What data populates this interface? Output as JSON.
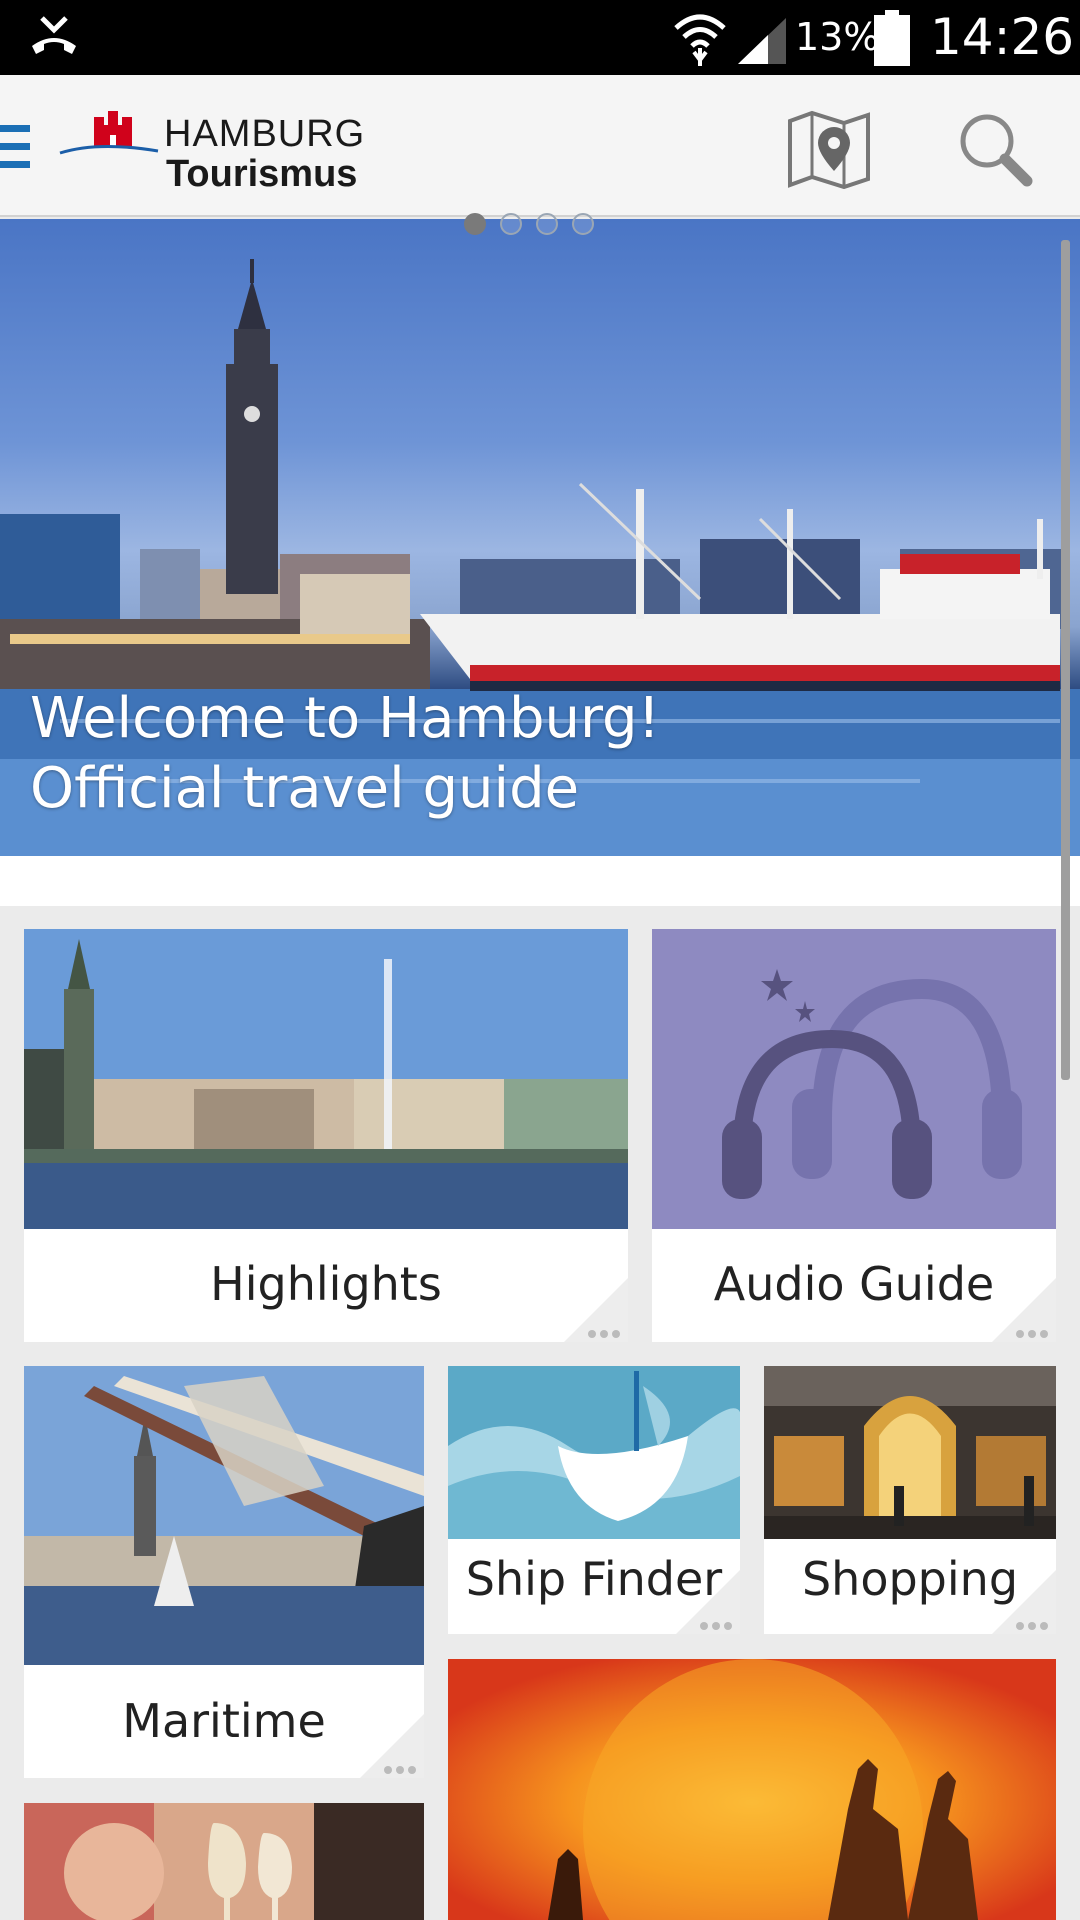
{
  "status_bar": {
    "battery_percent": "13%",
    "time": "14:26"
  },
  "app_bar": {
    "brand_line1": "HAMBURG",
    "brand_line2": "Tourismus"
  },
  "hero": {
    "caption_line1": "Welcome to Hamburg!",
    "caption_line2": "Official travel guide",
    "pager_count": 4,
    "pager_active": 1
  },
  "tiles": {
    "highlights": {
      "label": "Highlights"
    },
    "audio_guide": {
      "label": "Audio Guide"
    },
    "maritime": {
      "label": "Maritime"
    },
    "ship_finder": {
      "label": "Ship Finder"
    },
    "shopping": {
      "label": "Shopping"
    }
  },
  "colors": {
    "audio_guide_bg": "#8e8ac1",
    "ship_finder_bg": "#5ba9c7",
    "crest_red": "#d0021b",
    "logo_blue": "#1b5ea8"
  }
}
